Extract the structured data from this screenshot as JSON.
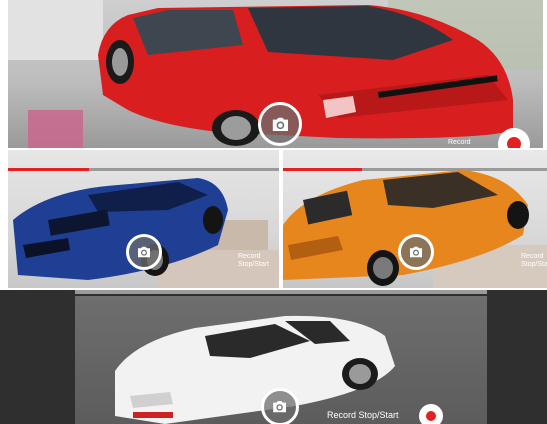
{
  "top": {
    "record_label": "Record",
    "colors": {
      "car": "#d81e1e",
      "record_dot": "#e52020"
    },
    "icons": {
      "capture": "camera-icon"
    }
  },
  "mid_left": {
    "record_label_1": "Record",
    "record_label_2": "Stop/Start",
    "progress_fraction": 0.3,
    "colors": {
      "car": "#1e3f93",
      "progress": "#e52020"
    },
    "icons": {
      "capture": "camera-icon"
    }
  },
  "mid_right": {
    "record_label_1": "Record",
    "record_label_2": "Stop/Start",
    "progress_fraction": 0.3,
    "colors": {
      "car": "#e8861e",
      "progress": "#e52020"
    },
    "icons": {
      "capture": "camera-icon"
    }
  },
  "bottom": {
    "record_label": "Record Stop/Start",
    "colors": {
      "car": "#f2f2f2",
      "record_dot": "#e52020"
    },
    "icons": {
      "capture": "camera-icon"
    }
  }
}
